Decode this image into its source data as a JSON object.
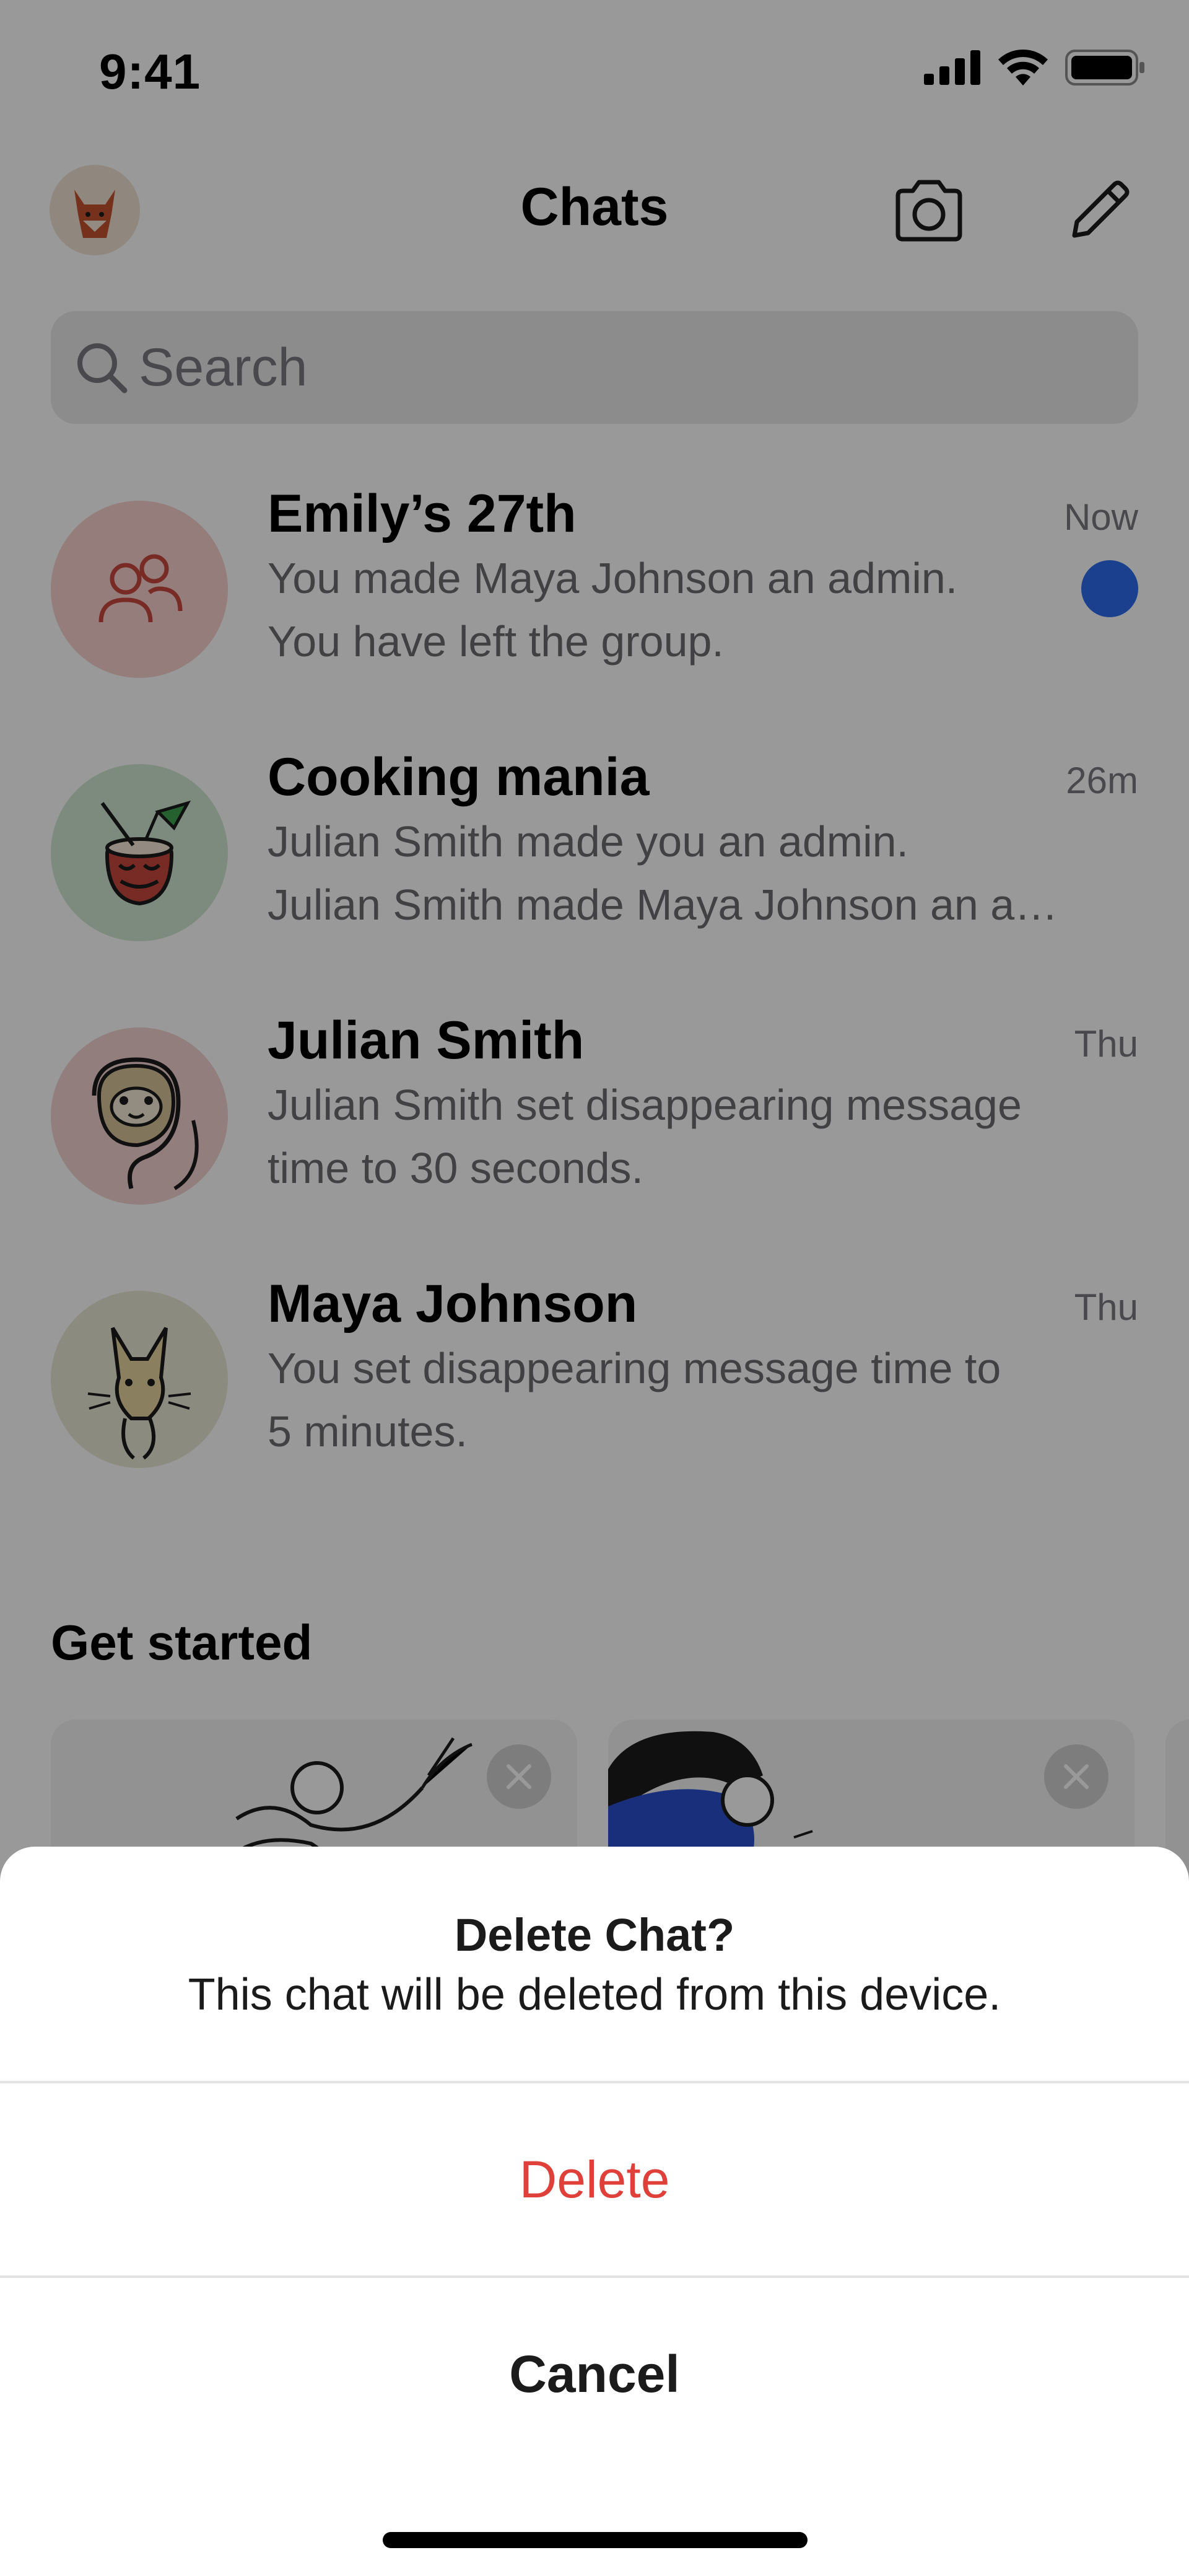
{
  "status_bar": {
    "time": "9:41"
  },
  "header": {
    "title": "Chats"
  },
  "search": {
    "placeholder": "Search"
  },
  "chats": [
    {
      "name": "Emily’s 27th",
      "time": "Now",
      "line1": "You made Maya Johnson an admin.",
      "line2": "You have left the group.",
      "unread": true,
      "avatar": "group-icon"
    },
    {
      "name": "Cooking mania",
      "time": "26m",
      "line1": "Julian Smith made you an admin.",
      "line2": "Julian Smith made Maya Johnson an a…",
      "unread": false,
      "avatar": "coconut-drink"
    },
    {
      "name": "Julian Smith",
      "time": "Thu",
      "line1": "Julian  Smith set disappearing message",
      "line2": "time to 30 seconds.",
      "unread": false,
      "avatar": "sloth"
    },
    {
      "name": "Maya Johnson",
      "time": "Thu",
      "line1": "You set disappearing message time to",
      "line2": "5 minutes.",
      "unread": false,
      "avatar": "cat"
    }
  ],
  "get_started": {
    "title": "Get started"
  },
  "dialog": {
    "title": "Delete Chat?",
    "message": "This chat will be deleted from this device.",
    "delete_label": "Delete",
    "cancel_label": "Cancel"
  },
  "colors": {
    "accent": "#2c6bed",
    "destructive": "#e0403a"
  }
}
